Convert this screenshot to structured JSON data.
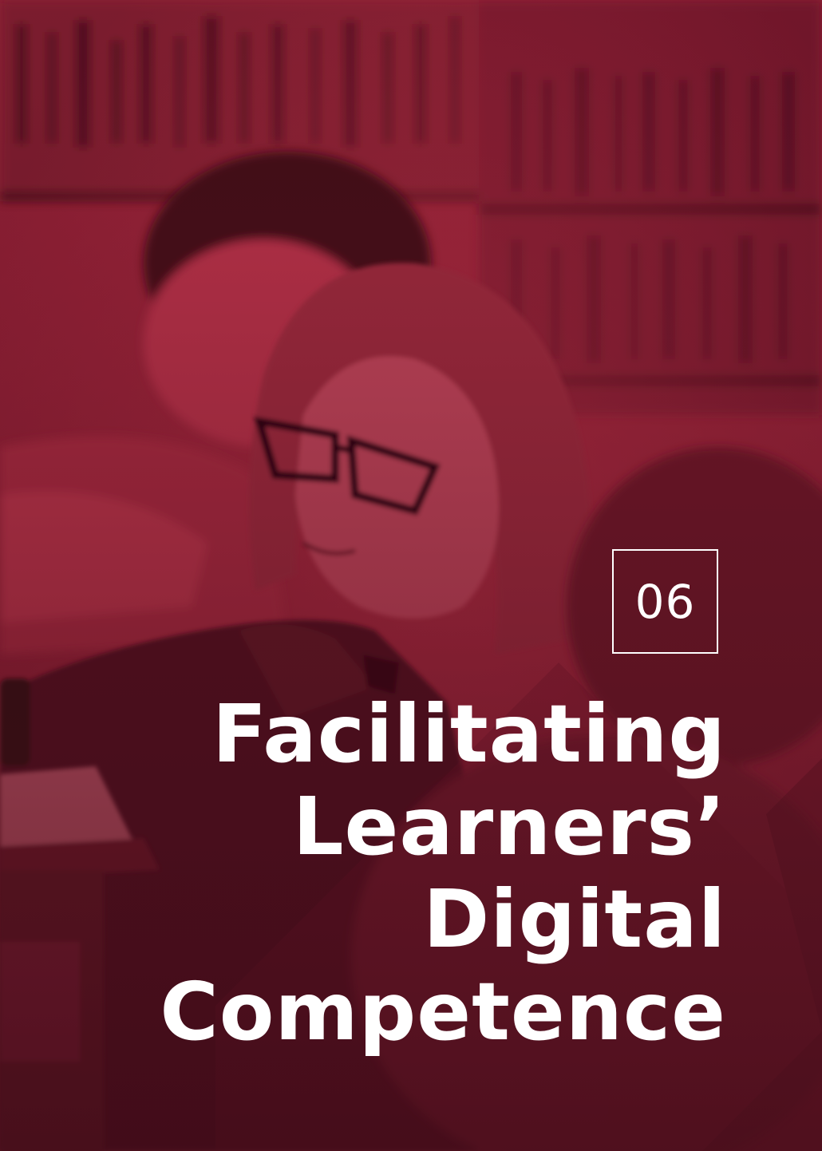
{
  "chapter": {
    "number": "06",
    "title_lines": [
      "Facilitating",
      "Learners’",
      "Digital",
      "Competence"
    ]
  },
  "photo": {
    "icon": "classroom-library-photo",
    "tint_color": "#8e1f34",
    "overlay_color": "#6e1428"
  }
}
